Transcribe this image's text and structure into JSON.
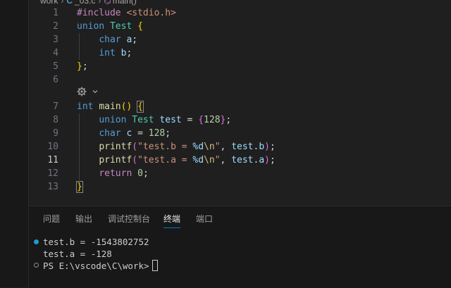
{
  "breadcrumb": {
    "folder": "work",
    "file": "_03.c",
    "symbol": "main()"
  },
  "editor": {
    "line_numbers": [
      "1",
      "2",
      "3",
      "4",
      "5",
      "6",
      "7",
      "8",
      "9",
      "10",
      "11",
      "12",
      "13"
    ],
    "active_line": "11",
    "lines": [
      [
        {
          "t": "#include",
          "c": "pp"
        },
        {
          "t": " "
        },
        {
          "t": "<stdio.h>",
          "c": "inc"
        }
      ],
      [
        {
          "t": "union",
          "c": "kw"
        },
        {
          "t": " "
        },
        {
          "t": "Test",
          "c": "type"
        },
        {
          "t": " "
        },
        {
          "t": "{",
          "c": "br1"
        }
      ],
      [
        {
          "t": "    "
        },
        {
          "t": "char",
          "c": "kw"
        },
        {
          "t": " "
        },
        {
          "t": "a",
          "c": "var"
        },
        {
          "t": ";"
        }
      ],
      [
        {
          "t": "    "
        },
        {
          "t": "int",
          "c": "kw"
        },
        {
          "t": " "
        },
        {
          "t": "b",
          "c": "var"
        },
        {
          "t": ";"
        }
      ],
      [
        {
          "t": "}",
          "c": "br1"
        },
        {
          "t": ";"
        }
      ],
      [],
      [
        {
          "t": "int",
          "c": "kw"
        },
        {
          "t": " "
        },
        {
          "t": "main",
          "c": "fn"
        },
        {
          "t": "()",
          "c": "br1"
        },
        {
          "t": " "
        },
        {
          "t": "{",
          "c": "br1 brbox"
        }
      ],
      [
        {
          "t": "    "
        },
        {
          "t": "union",
          "c": "kw"
        },
        {
          "t": " "
        },
        {
          "t": "Test",
          "c": "type"
        },
        {
          "t": " "
        },
        {
          "t": "test",
          "c": "var"
        },
        {
          "t": " = "
        },
        {
          "t": "{",
          "c": "br2"
        },
        {
          "t": "128",
          "c": "num"
        },
        {
          "t": "}",
          "c": "br2"
        },
        {
          "t": ";"
        }
      ],
      [
        {
          "t": "    "
        },
        {
          "t": "char",
          "c": "kw"
        },
        {
          "t": " "
        },
        {
          "t": "c",
          "c": "var"
        },
        {
          "t": " = "
        },
        {
          "t": "128",
          "c": "num"
        },
        {
          "t": ";"
        }
      ],
      [
        {
          "t": "    "
        },
        {
          "t": "printf",
          "c": "fn"
        },
        {
          "t": "(",
          "c": "br2"
        },
        {
          "t": "\"test.b = ",
          "c": "str"
        },
        {
          "t": "%d",
          "c": "fmt"
        },
        {
          "t": "\\n",
          "c": "esc"
        },
        {
          "t": "\"",
          "c": "str"
        },
        {
          "t": ", "
        },
        {
          "t": "test",
          "c": "var"
        },
        {
          "t": "."
        },
        {
          "t": "b",
          "c": "var"
        },
        {
          "t": ")",
          "c": "br2"
        },
        {
          "t": ";"
        }
      ],
      [
        {
          "t": "    "
        },
        {
          "t": "printf",
          "c": "fn"
        },
        {
          "t": "(",
          "c": "br2"
        },
        {
          "t": "\"test.a = ",
          "c": "str"
        },
        {
          "t": "%d",
          "c": "fmt"
        },
        {
          "t": "\\n",
          "c": "esc"
        },
        {
          "t": "\"",
          "c": "str"
        },
        {
          "t": ", "
        },
        {
          "t": "test",
          "c": "var"
        },
        {
          "t": "."
        },
        {
          "t": "a",
          "c": "var"
        },
        {
          "t": ")",
          "c": "br2"
        },
        {
          "t": ";"
        }
      ],
      [
        {
          "t": "    "
        },
        {
          "t": "return",
          "c": "ctl"
        },
        {
          "t": " "
        },
        {
          "t": "0",
          "c": "num"
        },
        {
          "t": ";"
        }
      ],
      [
        {
          "t": "}",
          "c": "br1 brbox"
        }
      ]
    ],
    "codelens_icon": "gear-icon",
    "codelens_chevron": "chevron-down-icon"
  },
  "panel": {
    "tabs": [
      "问题",
      "输出",
      "调试控制台",
      "终端",
      "端口"
    ],
    "active_tab": "终端",
    "terminal_lines": [
      "test.b = -1543802752",
      "test.a = -128",
      "PS E:\\vscode\\C\\work>"
    ],
    "colors": {
      "success_dot": "#1c9bd6",
      "accent": "#0078d4"
    }
  }
}
